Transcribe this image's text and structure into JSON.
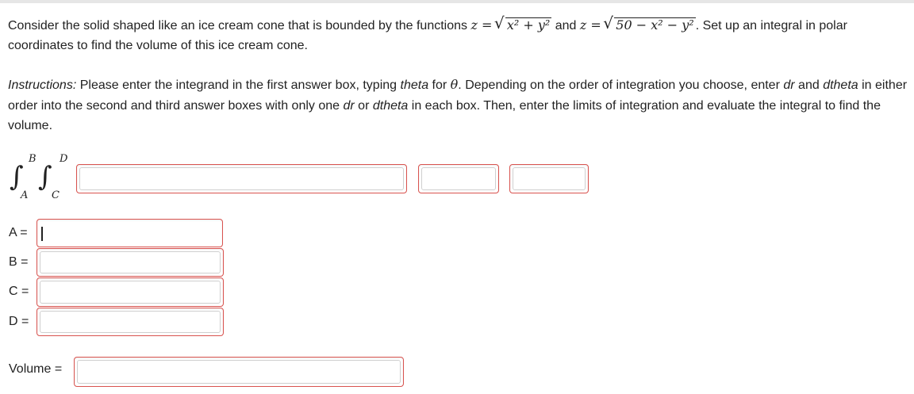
{
  "problem": {
    "text_before": "Consider the solid shaped like an ice cream cone that is bounded by the functions ",
    "z_eq": "z =",
    "func1": "x² + y²",
    "and": " and ",
    "z_eq2": "z =",
    "func2": "50 − x² − y²",
    "text_after": ". Set up an integral in polar coordinates to find the volume of this ice cream cone."
  },
  "instructions": {
    "label": "Instructions:",
    "part1": " Please enter the integrand in the first answer box, typing ",
    "theta_word": "theta",
    "part2": " for ",
    "theta_symbol": "θ",
    "part3": ". Depending on the order of integration you choose, enter ",
    "dr": "dr",
    "part4": " and ",
    "dtheta": "dtheta",
    "part5": " in either order into the second and third answer boxes with only one ",
    "dr2": "dr",
    "part6": " or ",
    "dtheta2": "dtheta",
    "part7": " in each box. Then, enter the limits of integration and evaluate the integral to find the volume."
  },
  "integral": {
    "outer_upper": "B",
    "outer_lower": "A",
    "inner_upper": "D",
    "inner_lower": "C",
    "sign": "∫"
  },
  "limits": {
    "a_label": "A =",
    "b_label": "B =",
    "c_label": "C =",
    "d_label": "D ="
  },
  "volume_label": "Volume ="
}
